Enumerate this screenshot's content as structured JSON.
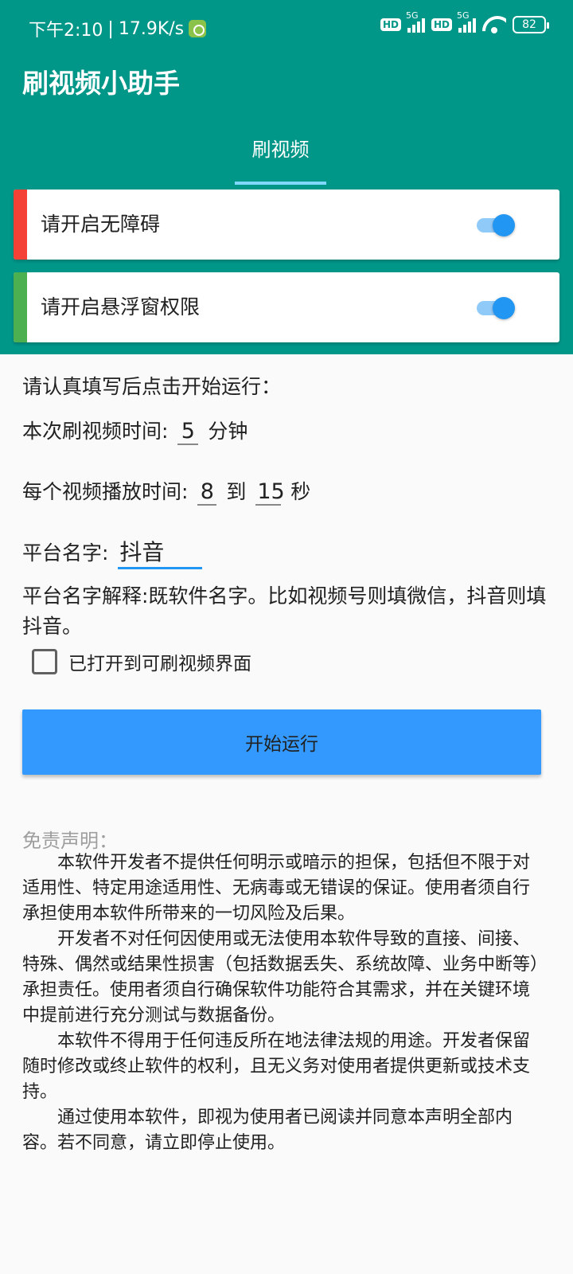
{
  "status_bar": {
    "time": "下午2:10",
    "speed": "17.9K/s",
    "hd1": "HD",
    "net1": "5G",
    "hd2": "HD",
    "net2": "5G",
    "battery": "82"
  },
  "app": {
    "title": "刷视频小助手",
    "tab_label": "刷视频",
    "accent": "#009688"
  },
  "permissions": [
    {
      "label": "请开启无障碍",
      "enabled": true,
      "color": "#f44336"
    },
    {
      "label": "请开启悬浮窗权限",
      "enabled": true,
      "color": "#4caf50"
    }
  ],
  "form": {
    "intro": "请认真填写后点击开始运行：",
    "duration_label": "本次刷视频时间:",
    "duration_value": "5",
    "duration_unit": "分钟",
    "per_video_label": "每个视频播放时间:",
    "per_video_min": "8",
    "per_video_to": "到",
    "per_video_max": "15",
    "per_video_unit": "秒",
    "platform_label": "平台名字:",
    "platform_value": "抖音",
    "platform_hint": "平台名字解释:既软件名字。比如视频号则填微信，抖音则填抖音。",
    "checkbox_label": "已打开到可刷视频界面",
    "checkbox_checked": false,
    "start_button": "开始运行"
  },
  "disclaimer": {
    "title": "免责声明：",
    "paragraphs": [
      "本软件开发者不提供任何明示或暗示的担保，包括但不限于对适用性、特定用途适用性、无病毒或无错误的保证。使用者须自行承担使用本软件所带来的一切风险及后果。",
      "开发者不对任何因使用或无法使用本软件导致的直接、间接、特殊、偶然或结果性损害（包括数据丢失、系统故障、业务中断等）承担责任。使用者须自行确保软件功能符合其需求，并在关键环境中提前进行充分测试与数据备份。",
      "本软件不得用于任何违反所在地法律法规的用途。开发者保留随时修改或终止软件的权利，且无义务对使用者提供更新或技术支持。",
      "通过使用本软件，即视为使用者已阅读并同意本声明全部内容。若不同意，请立即停止使用。"
    ]
  }
}
